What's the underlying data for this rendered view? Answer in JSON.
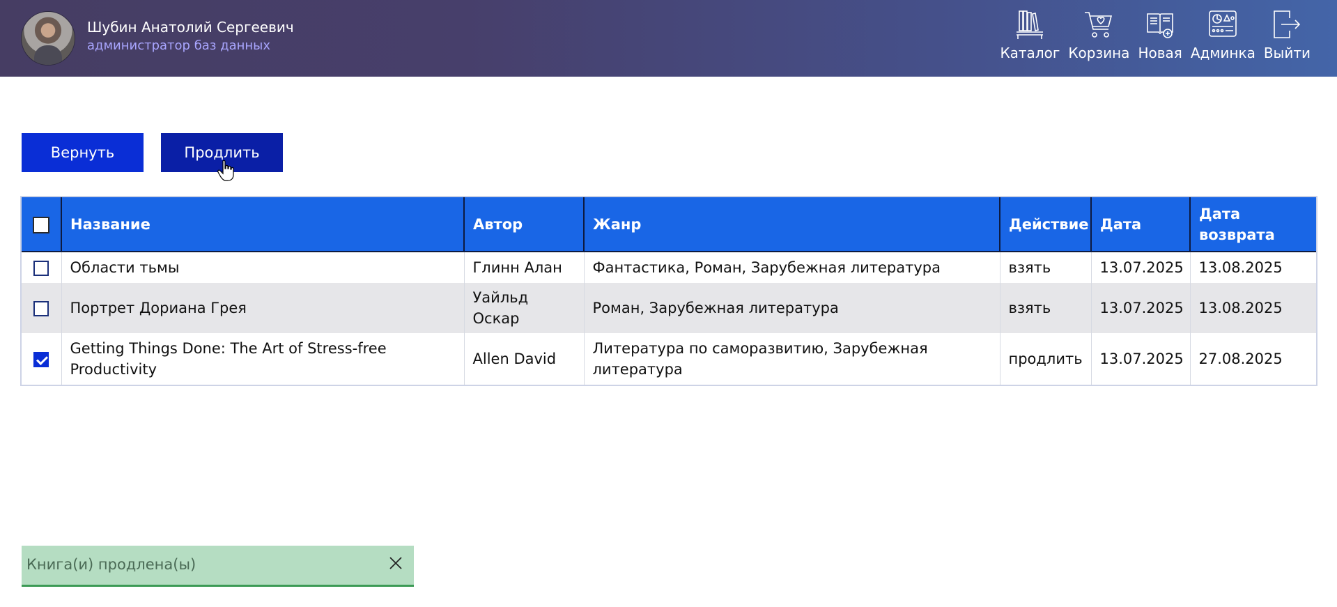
{
  "header": {
    "user_name": "Шубин Анатолий Сергеевич",
    "user_role": "администратор баз данных",
    "nav": [
      {
        "label": "Каталог",
        "icon": "bookshelf-icon"
      },
      {
        "label": "Корзина",
        "icon": "cart-icon"
      },
      {
        "label": "Новая",
        "icon": "new-book-icon"
      },
      {
        "label": "Админка",
        "icon": "dashboard-icon"
      },
      {
        "label": "Выйти",
        "icon": "logout-icon"
      }
    ]
  },
  "actions": {
    "return_label": "Вернуть",
    "extend_label": "Продлить"
  },
  "table": {
    "columns": [
      "Название",
      "Автор",
      "Жанр",
      "Действие",
      "Дата",
      "Дата возврата"
    ],
    "rows": [
      {
        "checked": false,
        "title": "Области тьмы",
        "author": "Глинн Алан",
        "genre": "Фантастика, Роман, Зарубежная литература",
        "action": "взять",
        "date": "13.07.2025",
        "return_date": "13.08.2025"
      },
      {
        "checked": false,
        "title": "Портрет Дориана Грея",
        "author": "Уайльд Оскар",
        "genre": "Роман, Зарубежная литература",
        "action": "взять",
        "date": "13.07.2025",
        "return_date": "13.08.2025"
      },
      {
        "checked": true,
        "title": "Getting Things Done: The Art of Stress-free Productivity",
        "author": "Allen David",
        "genre": "Литература по саморазвитию, Зарубежная литература",
        "action": "продлить",
        "date": "13.07.2025",
        "return_date": "27.08.2025"
      }
    ]
  },
  "toast": {
    "message": "Книга(и) продлена(ы)"
  },
  "colors": {
    "primary_button": "#0a2ed6",
    "table_header": "#1966e6",
    "toast_bg": "#b5ddc2",
    "toast_border": "#3c9a55",
    "user_role": "#a9a6ff"
  }
}
